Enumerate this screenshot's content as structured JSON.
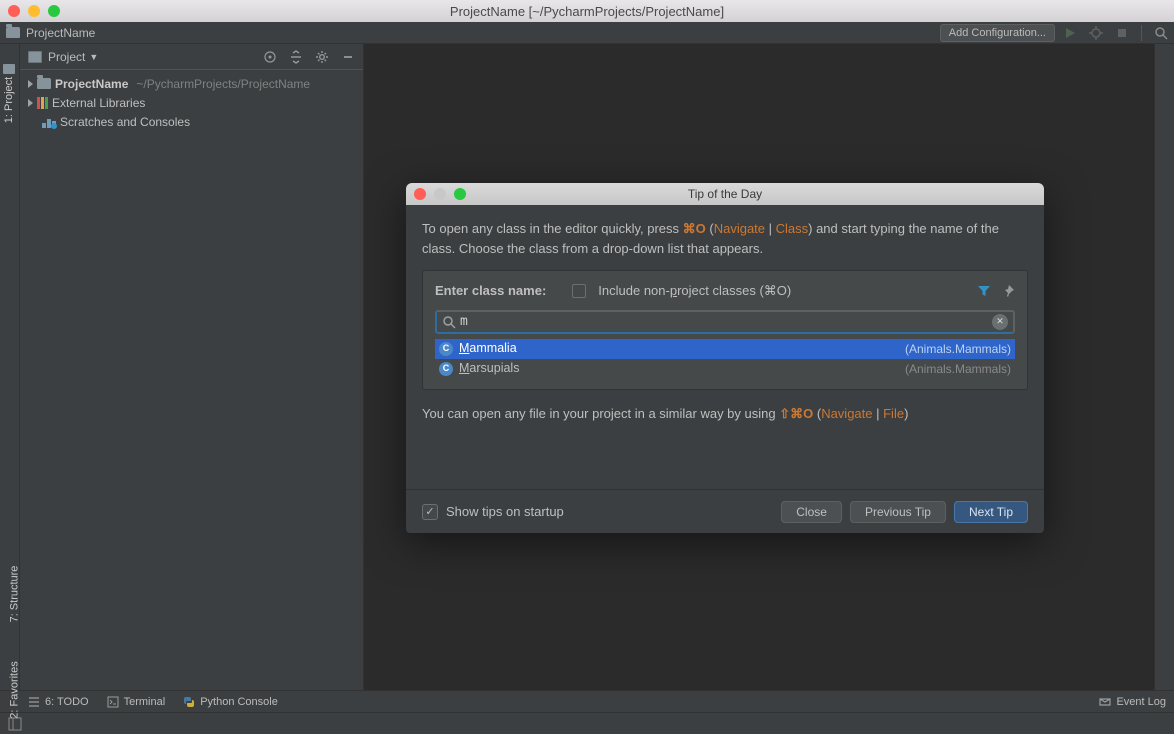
{
  "titlebar": {
    "title": "ProjectName [~/PycharmProjects/ProjectName]"
  },
  "nav": {
    "breadcrumb": "ProjectName",
    "addConfig": "Add Configuration..."
  },
  "gutter": {
    "project": "1: Project",
    "structure": "7: Structure",
    "favorites": "2: Favorites"
  },
  "projectPanel": {
    "header": "Project",
    "tree": {
      "root": {
        "name": "ProjectName",
        "path": "~/PycharmProjects/ProjectName"
      },
      "ext": "External Libraries",
      "scratch": "Scratches and Consoles"
    }
  },
  "dialog": {
    "title": "Tip of the Day",
    "line1_a": "To open any class in the editor quickly, press ",
    "shortcut1": "⌘O",
    "line1_b": " (",
    "nav1a": "Navigate",
    "nav1b": "Class",
    "line1_c": ") and start typing the name of the class. Choose the class from a drop-down list that appears.",
    "sb": {
      "label": "Enter class name:",
      "chkLabel": "Include non-project classes (⌘O)",
      "inputValue": "m",
      "inputPlaceholder": "",
      "results": [
        {
          "name": "Mammalia",
          "path": "(Animals.Mammals)",
          "sel": true
        },
        {
          "name": "Marsupials",
          "path": "(Animals.Mammals)",
          "sel": false
        }
      ]
    },
    "line2_a": "You can open any file in your project in a similar way by using ",
    "shortcut2": "⇧⌘O",
    "line2_b": " (",
    "nav2a": "Navigate",
    "nav2b": "File",
    "line2_c": ")",
    "showTips": "Show tips on startup",
    "close": "Close",
    "prev": "Previous Tip",
    "next": "Next Tip"
  },
  "status": {
    "todo": "6: TODO",
    "terminal": "Terminal",
    "pyconsole": "Python Console",
    "eventLog": "Event Log"
  }
}
